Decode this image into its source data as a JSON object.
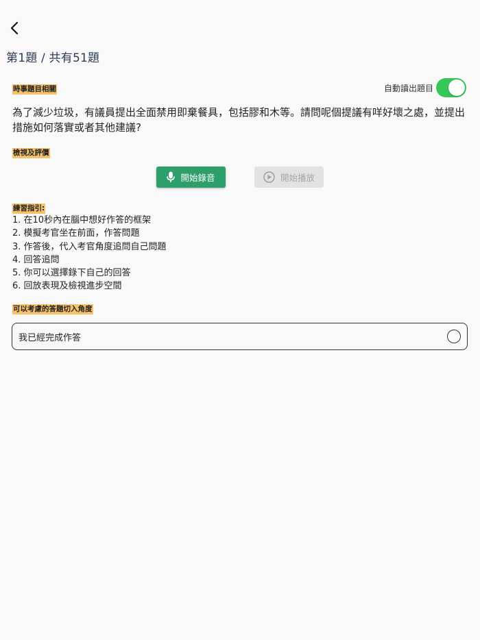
{
  "header": {
    "back_icon": "chevron-left-icon",
    "progress_title": "第1題 / 共有51題"
  },
  "topic": {
    "tag_label": "時事題目相關",
    "auto_read_label": "自動讀出題目",
    "auto_read_enabled": true,
    "toggle_color": "#34c759",
    "question_text": "為了減少垃圾，有議員提出全面禁用即棄餐具，包括膠和木等。請問呢個提議有咩好壞之處，並提出措施如何落實或者其他建議?"
  },
  "review": {
    "tag_label": "檢視及評價",
    "record_button": {
      "label": "開始錄音",
      "icon": "microphone-icon",
      "color": "#2e9e6b"
    },
    "play_button": {
      "label": "開始播放",
      "icon": "play-circle-icon",
      "disabled": true
    }
  },
  "guide": {
    "tag_label": "練習指引:",
    "items": [
      "1. 在10秒內在腦中想好作答的框架",
      "2. 模擬考官坐在前面，作答問題",
      "3. 作答後，代入考官角度追問自己問題",
      "4. 回答追問",
      "5. 你可以選擇錄下自己的回答",
      "6. 回放表現及檢視進步空間"
    ]
  },
  "angles": {
    "tag_label": "可以考慮的答題切入角度"
  },
  "completion": {
    "label": "我已經完成作答",
    "checked": false
  },
  "colors": {
    "tag_highlight": "#f5c26b",
    "title_color": "#2b3a55"
  }
}
